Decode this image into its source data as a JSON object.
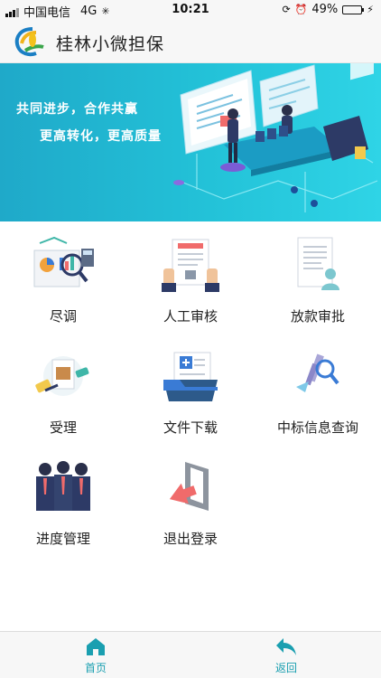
{
  "status_bar": {
    "carrier": "中国电信",
    "network": "4G",
    "time": "10:21",
    "battery_percent": "49%",
    "battery_level": 0.49
  },
  "header": {
    "title": "桂林小微担保"
  },
  "banner": {
    "slogan_line1": "共同进步，合作共赢",
    "slogan_line2": "更高转化，更高质量"
  },
  "menu": {
    "items": [
      {
        "label": "尽调",
        "icon": "due-diligence-icon"
      },
      {
        "label": "人工审核",
        "icon": "manual-review-icon"
      },
      {
        "label": "放款审批",
        "icon": "loan-approval-icon"
      },
      {
        "label": "受理",
        "icon": "accept-icon"
      },
      {
        "label": "文件下载",
        "icon": "file-download-icon"
      },
      {
        "label": "中标信息查询",
        "icon": "bid-info-query-icon"
      },
      {
        "label": "进度管理",
        "icon": "progress-management-icon"
      },
      {
        "label": "退出登录",
        "icon": "logout-icon"
      }
    ]
  },
  "tabbar": {
    "home_label": "首页",
    "back_label": "返回"
  },
  "colors": {
    "accent": "#1a9fb0",
    "banner_start": "#1fa9c9",
    "banner_end": "#2fd4e6"
  }
}
